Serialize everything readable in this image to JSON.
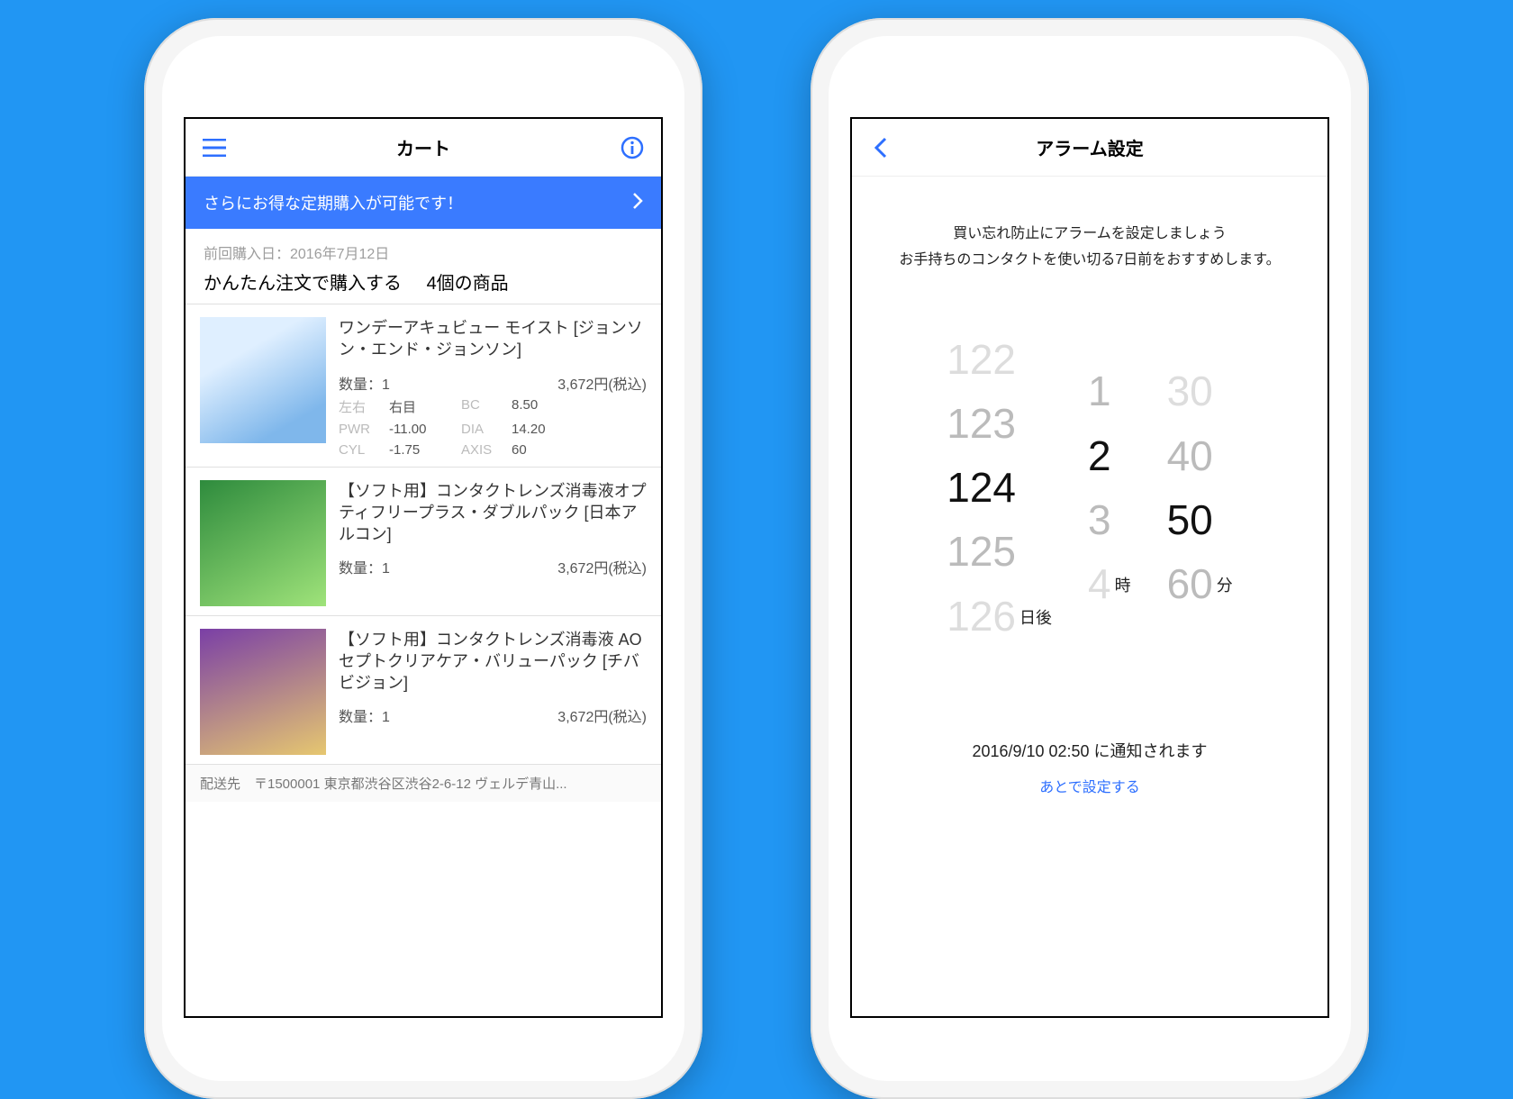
{
  "left": {
    "nav": {
      "title": "カート"
    },
    "banner": {
      "text": "さらにお得な定期購入が可能です！"
    },
    "meta": {
      "prev_label": "前回購入日：2016年7月12日",
      "summary_lead": "かんたん注文で購入する",
      "summary_count": "4個の商品"
    },
    "items": [
      {
        "name": "ワンデーアキュビュー モイスト [ジョンソン・エンド・ジョンソン]",
        "qty_label": "数量：1",
        "price": "3,672円(税込)",
        "specs": {
          "lr_label": "左右",
          "lr_val": "右目",
          "bc_label": "BC",
          "bc_val": "8.50",
          "pwr_label": "PWR",
          "pwr_val": "-11.00",
          "dia_label": "DIA",
          "dia_val": "14.20",
          "cyl_label": "CYL",
          "cyl_val": "-1.75",
          "axis_label": "AXIS",
          "axis_val": "60"
        }
      },
      {
        "name": "【ソフト用】コンタクトレンズ消毒液オプティフリープラス・ダブルパック [日本アルコン]",
        "qty_label": "数量：1",
        "price": "3,672円(税込)"
      },
      {
        "name": "【ソフト用】コンタクトレンズ消毒液 AOセプトクリアケア・バリューパック [チバビジョン]",
        "qty_label": "数量：1",
        "price": "3,672円(税込)"
      }
    ],
    "shipping": "配送先　〒1500001 東京都渋谷区渋谷2-6-12 ヴェルデ青山..."
  },
  "right": {
    "nav": {
      "title": "アラーム設定"
    },
    "msg_line1": "買い忘れ防止にアラームを設定しましょう",
    "msg_line2": "お手持ちのコンタクトを使い切る7日前をおすすめします。",
    "picker": {
      "days": {
        "opts": [
          "122",
          "123",
          "124",
          "125",
          "126"
        ],
        "selected": "124",
        "unit": "日後"
      },
      "hours": {
        "opts": [
          "",
          "1",
          "2",
          "3",
          "4"
        ],
        "selected": "2",
        "unit": "時"
      },
      "mins": {
        "opts": [
          "30",
          "40",
          "50",
          "60",
          ""
        ],
        "selected": "50",
        "unit": "分"
      }
    },
    "notify_text": "2016/9/10 02:50 に通知されます",
    "later_text": "あとで設定する"
  }
}
